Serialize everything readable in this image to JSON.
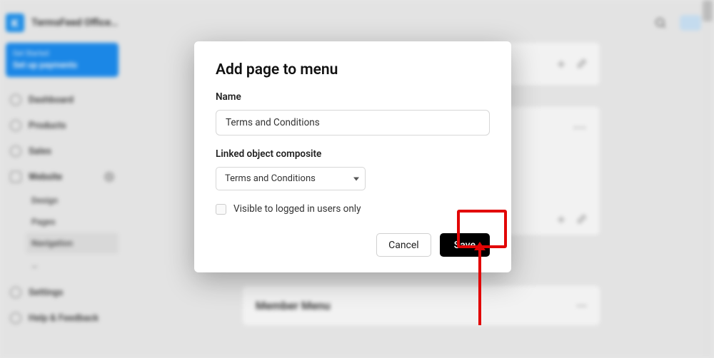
{
  "topbar": {
    "logo_letter": "K",
    "site_title": "TermsFeed Office…"
  },
  "sidebar": {
    "alert": {
      "line1": "Get Started",
      "line2": "Set up payments"
    },
    "items": [
      {
        "label": "Dashboard"
      },
      {
        "label": "Products"
      },
      {
        "label": "Sales"
      },
      {
        "label": "Website"
      }
    ],
    "sub_items": [
      {
        "label": "Design"
      },
      {
        "label": "Pages"
      },
      {
        "label": "Navigation"
      },
      {
        "label": "…"
      }
    ],
    "footer": [
      {
        "label": "Settings"
      },
      {
        "label": "Help & Feedback"
      }
    ]
  },
  "main": {
    "add_label": "+  Add",
    "member_menu_title": "Member Menu"
  },
  "modal": {
    "title": "Add page to menu",
    "name_label": "Name",
    "name_value": "Terms and Conditions",
    "linked_label": "Linked object composite",
    "linked_value": "Terms and Conditions",
    "visibility_label": "Visible to logged in users only",
    "cancel_label": "Cancel",
    "save_label": "Save"
  }
}
